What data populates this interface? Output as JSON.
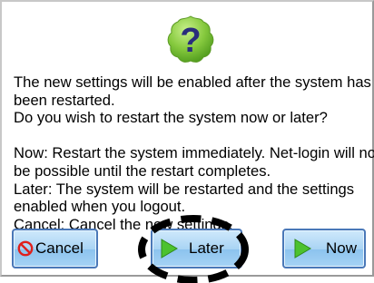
{
  "message": {
    "lines": [
      "The new settings will be enabled after the system has",
      "been restarted.",
      "Do you wish to restart the system now or later?",
      "",
      "Now: Restart the system immediately. Net-login will not",
      "be possible until the restart completes.",
      "Later: The system will be restarted and the settings",
      "enabled when you logout.",
      "Cancel: Cancel the new settings."
    ]
  },
  "buttons": {
    "cancel": "Cancel",
    "later": "Later",
    "now": "Now"
  },
  "icons": {
    "badge": "question-mark-icon",
    "cancel": "no-entry-icon",
    "later": "play-arrow-icon",
    "now": "play-arrow-icon"
  },
  "colors": {
    "badge_green": "#7ec43a",
    "badge_question": "#2a2d7c",
    "button_blue": "#a9d4f4",
    "cancel_red": "#e0201c",
    "arrow_green": "#4cc22e"
  }
}
